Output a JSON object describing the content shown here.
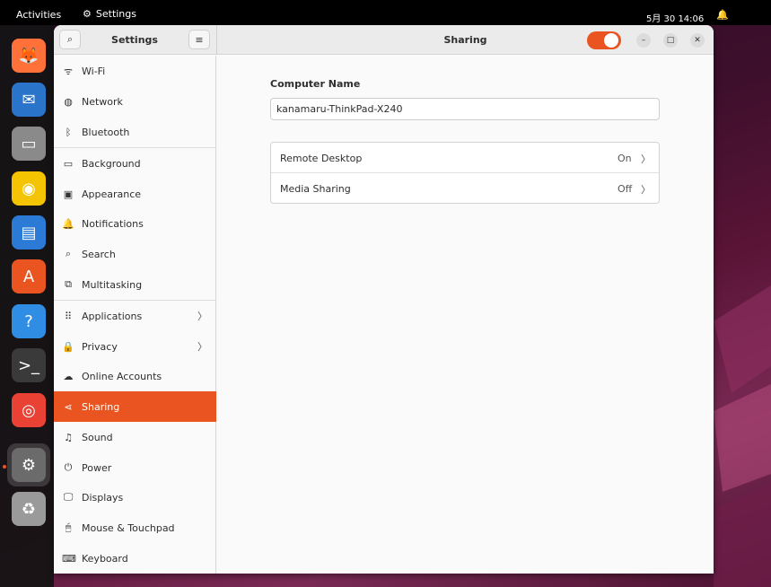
{
  "topbar": {
    "activities": "Activities",
    "app_name": "Settings",
    "clock": "5月 30 14:06"
  },
  "dock": {
    "items": [
      {
        "name": "firefox",
        "glyph": "🦊",
        "bg": "#ff7139"
      },
      {
        "name": "thunderbird",
        "glyph": "✉",
        "bg": "#2a74c9"
      },
      {
        "name": "files",
        "glyph": "▭",
        "bg": "#8a8a8a"
      },
      {
        "name": "rhythmbox",
        "glyph": "◉",
        "bg": "#f5c400"
      },
      {
        "name": "libreoffice-writer",
        "glyph": "▤",
        "bg": "#2b7bd6"
      },
      {
        "name": "app-center",
        "glyph": "A",
        "bg": "#e95420"
      },
      {
        "name": "help",
        "glyph": "?",
        "bg": "#2f8de4"
      },
      {
        "name": "terminal",
        "glyph": ">_",
        "bg": "#3a3a3a"
      },
      {
        "name": "chrome",
        "glyph": "◎",
        "bg": "#e94235"
      },
      {
        "name": "settings",
        "glyph": "⚙",
        "bg": "#6b6b6b"
      },
      {
        "name": "trash",
        "glyph": "♻",
        "bg": "#9a9a9a"
      }
    ]
  },
  "header": {
    "settings_title": "Settings",
    "page_title": "Sharing",
    "sharing_enabled": true
  },
  "sidebar": {
    "items": [
      {
        "key": "wifi",
        "label": "Wi-Fi",
        "icon": "wifi-icon",
        "glyph": "ᯤ"
      },
      {
        "key": "network",
        "label": "Network",
        "icon": "network-icon",
        "glyph": "◍"
      },
      {
        "key": "bluetooth",
        "label": "Bluetooth",
        "icon": "bluetooth-icon",
        "glyph": "ᛒ"
      },
      {
        "key": "background",
        "label": "Background",
        "icon": "background-icon",
        "glyph": "▭"
      },
      {
        "key": "appearance",
        "label": "Appearance",
        "icon": "appearance-icon",
        "glyph": "▣"
      },
      {
        "key": "notifications",
        "label": "Notifications",
        "icon": "bell-icon",
        "glyph": "🔔"
      },
      {
        "key": "search",
        "label": "Search",
        "icon": "search-icon",
        "glyph": "⌕"
      },
      {
        "key": "multitasking",
        "label": "Multitasking",
        "icon": "multitasking-icon",
        "glyph": "⧉"
      },
      {
        "key": "applications",
        "label": "Applications",
        "icon": "applications-icon",
        "glyph": "⠿",
        "chevron": "〉"
      },
      {
        "key": "privacy",
        "label": "Privacy",
        "icon": "lock-icon",
        "glyph": "🔒",
        "chevron": "〉"
      },
      {
        "key": "online-accounts",
        "label": "Online Accounts",
        "icon": "cloud-icon",
        "glyph": "☁"
      },
      {
        "key": "sharing",
        "label": "Sharing",
        "icon": "share-icon",
        "glyph": "⋖",
        "active": true
      },
      {
        "key": "sound",
        "label": "Sound",
        "icon": "music-note-icon",
        "glyph": "♫"
      },
      {
        "key": "power",
        "label": "Power",
        "icon": "power-icon",
        "glyph": "⏻"
      },
      {
        "key": "displays",
        "label": "Displays",
        "icon": "display-icon",
        "glyph": "🖵"
      },
      {
        "key": "mouse-touchpad",
        "label": "Mouse & Touchpad",
        "icon": "mouse-icon",
        "glyph": "🖱"
      },
      {
        "key": "keyboard",
        "label": "Keyboard",
        "icon": "keyboard-icon",
        "glyph": "⌨"
      }
    ]
  },
  "content": {
    "computer_name_label": "Computer Name",
    "computer_name_value": "kanamaru-ThinkPad-X240",
    "rows": [
      {
        "label": "Remote Desktop",
        "status": "On",
        "chevron": "〉"
      },
      {
        "label": "Media Sharing",
        "status": "Off",
        "chevron": "〉"
      }
    ]
  },
  "colors": {
    "accent": "#e95420"
  }
}
